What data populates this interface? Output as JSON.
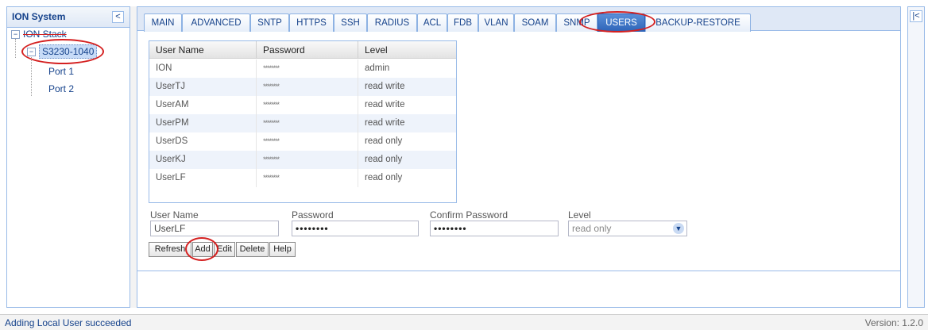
{
  "left_panel": {
    "title": "ION System",
    "collapse_symbol": "<",
    "tree": {
      "root": {
        "label": "ION Stack",
        "toggle": "−"
      },
      "device": {
        "label": "S3230-1040",
        "toggle": "−"
      },
      "ports": [
        {
          "label": "Port 1"
        },
        {
          "label": "Port 2"
        }
      ]
    }
  },
  "tabs": [
    {
      "label": "MAIN"
    },
    {
      "label": "ADVANCED"
    },
    {
      "label": "SNTP"
    },
    {
      "label": "HTTPS"
    },
    {
      "label": "SSH"
    },
    {
      "label": "RADIUS"
    },
    {
      "label": "ACL"
    },
    {
      "label": "FDB"
    },
    {
      "label": "VLAN"
    },
    {
      "label": "SOAM"
    },
    {
      "label": "SNMP"
    },
    {
      "label": "USERS",
      "active": true
    },
    {
      "label": "BACKUP-RESTORE"
    }
  ],
  "users_grid": {
    "columns": [
      "User Name",
      "Password",
      "Level"
    ],
    "rows": [
      {
        "user": "ION",
        "password": "********",
        "level": "admin"
      },
      {
        "user": "UserTJ",
        "password": "********",
        "level": "read write"
      },
      {
        "user": "UserAM",
        "password": "********",
        "level": "read write"
      },
      {
        "user": "UserPM",
        "password": "********",
        "level": "read write"
      },
      {
        "user": "UserDS",
        "password": "********",
        "level": "read only"
      },
      {
        "user": "UserKJ",
        "password": "********",
        "level": "read only"
      },
      {
        "user": "UserLF",
        "password": "********",
        "level": "read only"
      }
    ]
  },
  "form": {
    "user_name_label": "User Name",
    "user_name_value": "UserLF",
    "password_label": "Password",
    "password_value": "••••••••",
    "confirm_label": "Confirm Password",
    "confirm_value": "••••••••",
    "level_label": "Level",
    "level_value": "read only"
  },
  "buttons": {
    "refresh": "Refresh",
    "add": "Add",
    "edit": "Edit",
    "delete": "Delete",
    "help": "Help"
  },
  "right_panel": {
    "collapse_symbol": "|<"
  },
  "status": {
    "message": "Adding Local User succeeded",
    "version": "Version: 1.2.0"
  },
  "colors": {
    "highlight": "#d42020",
    "active_tab": "#2c63b8",
    "header_text": "#15428b"
  }
}
